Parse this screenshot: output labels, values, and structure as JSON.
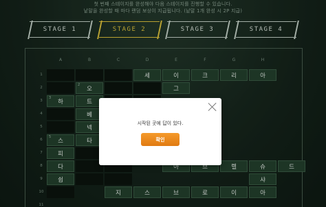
{
  "notice": {
    "line1": "첫 번째 스테이지를 완성해야 다음 스테이지를 진행할 수 있습니다.",
    "line2": "낱말을 완성할 때 마다 랜덤 보상이 지급됩니다. (낱말 1개 완성 시 2P 지급)"
  },
  "stages": [
    {
      "label": "STAGE 1",
      "active": false
    },
    {
      "label": "STAGE 2",
      "active": true
    },
    {
      "label": "STAGE 3",
      "active": false
    },
    {
      "label": "STAGE 4",
      "active": false
    }
  ],
  "columns": [
    "A",
    "B",
    "C",
    "D",
    "E",
    "F",
    "G",
    "H"
  ],
  "rows": [
    "1",
    "2",
    "3",
    "4",
    "5",
    "6",
    "7",
    "8",
    "9",
    "10",
    "11"
  ],
  "cells": {
    "r1": {
      "c4": "세",
      "c5": "이",
      "c6": "크",
      "c7": "리",
      "c8": "아"
    },
    "r2": {
      "c2": "오",
      "c5": "그",
      "num_c2": "2"
    },
    "r3": {
      "c1": "하",
      "c2": "트",
      "num_c1": "3"
    },
    "r4": {
      "c2": "베"
    },
    "r5": {
      "c2": "넥"
    },
    "r6": {
      "c1": "스",
      "c2": "타",
      "num_c1": "5"
    },
    "r7": {
      "c1": "피"
    },
    "r8": {
      "c1": "다",
      "c5": "아",
      "c6": "브",
      "c7": "렐",
      "c8": "슈",
      "c9": "드"
    },
    "r9": {
      "c1": "쉽",
      "c8": "샤"
    },
    "r10": {
      "c3": "지",
      "c4": "스",
      "c5": "브",
      "c6": "로",
      "c7": "이",
      "c8": "아"
    }
  },
  "modal": {
    "message": "시작된 곳에 답이 있다.",
    "confirm_label": "확인"
  }
}
